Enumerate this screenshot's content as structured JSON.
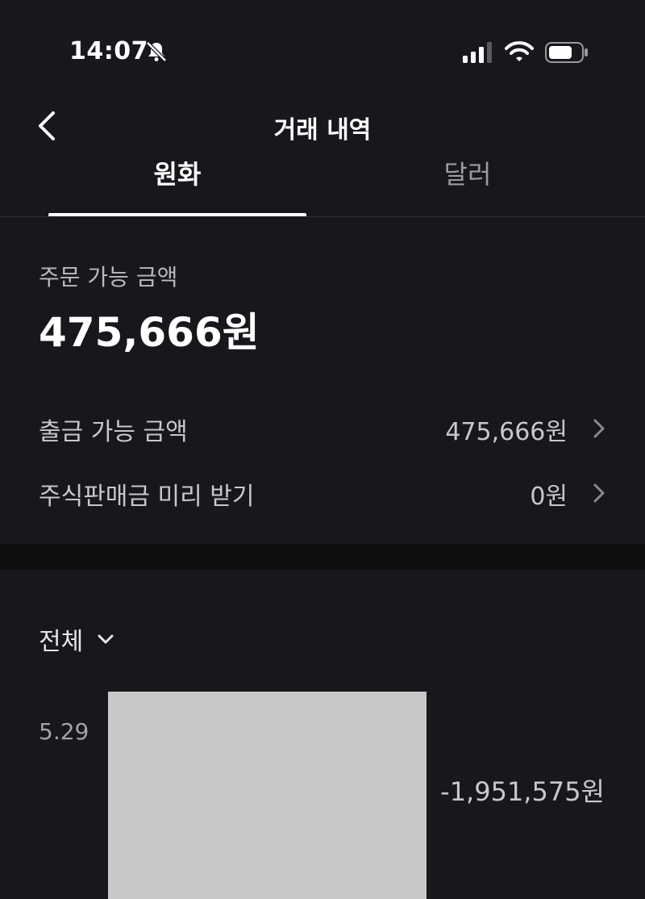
{
  "status": {
    "time": "14:07",
    "icons": [
      "bell-muted-icon",
      "signal-icon",
      "wifi-icon",
      "battery-icon"
    ]
  },
  "nav": {
    "title": "거래 내역",
    "back_icon": "back-chevron-icon"
  },
  "tabs": [
    {
      "label": "원화",
      "active": true
    },
    {
      "label": "달러",
      "active": false
    }
  ],
  "summary": {
    "label": "주문 가능 금액",
    "amount": "475,666원"
  },
  "rows": [
    {
      "label": "출금 가능 금액",
      "value": "475,666원"
    },
    {
      "label": "주식판매금 미리 받기",
      "value": "0원"
    }
  ],
  "filter": {
    "label": "전체"
  },
  "transactions": [
    {
      "date": "5.29",
      "amount": "-1,951,575원"
    }
  ],
  "colors": {
    "background": "#17171c",
    "text_primary": "#ffffff",
    "text_secondary": "#c7c7cd",
    "tab_inactive": "#9b9ba3",
    "separator": "#0e0e11"
  }
}
